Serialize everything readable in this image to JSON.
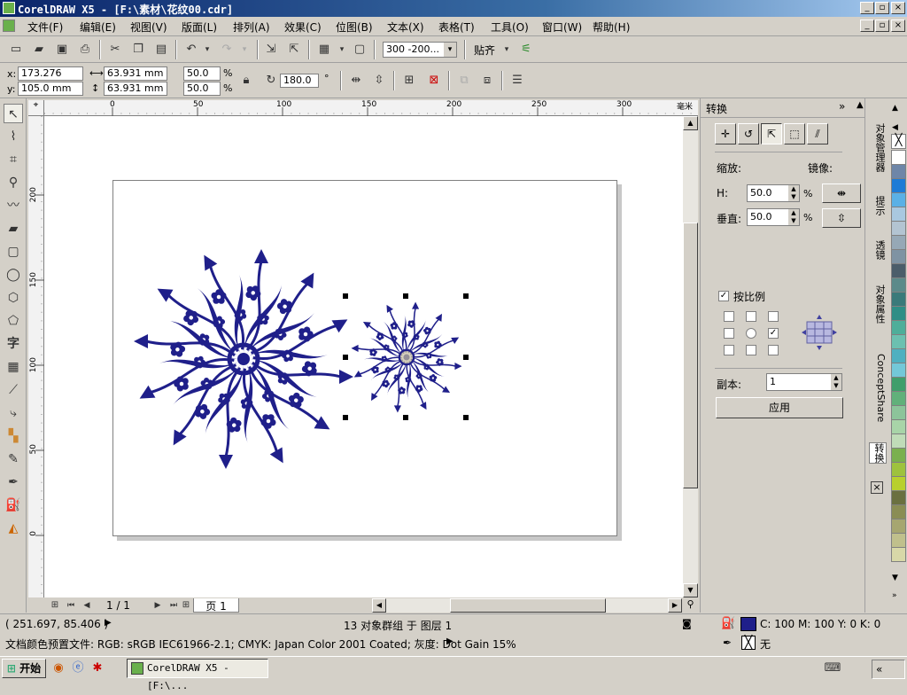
{
  "window": {
    "title": "CorelDRAW X5 - [F:\\素材\\花纹00.cdr]"
  },
  "menu": [
    "文件(F)",
    "编辑(E)",
    "视图(V)",
    "版面(L)",
    "排列(A)",
    "效果(C)",
    "位图(B)",
    "文本(X)",
    "表格(T)",
    "工具(O)",
    "窗口(W)",
    "帮助(H)"
  ],
  "toolbar": {
    "zoom_value": "300 -200...",
    "snap_label": "贴齐"
  },
  "propbar": {
    "x_label": "x:",
    "x_value": "173.276 mm",
    "y_label": "y:",
    "y_value": "105.0 mm",
    "w_value": "63.931 mm",
    "h_value": "63.931 mm",
    "sx_value": "50.0",
    "sy_value": "50.0",
    "percent": "%",
    "angle_value": "180.0",
    "deg": "°"
  },
  "ruler": {
    "h_ticks": [
      "0",
      "50",
      "100",
      "150",
      "200",
      "250",
      "300"
    ],
    "v_ticks": [
      "200",
      "150",
      "100",
      "50",
      "0"
    ],
    "unit": "毫米"
  },
  "page_nav": {
    "counter": "1 / 1",
    "page_tab": "页 1"
  },
  "docker": {
    "title": "转换",
    "scale_label": "缩放:",
    "mirror_label": "镜像:",
    "h_label": "H:",
    "h_value": "50.0",
    "v_label": "垂直:",
    "v_value": "50.0",
    "percent": "%",
    "proportional_label": "按比例",
    "copies_label": "副本:",
    "copies_value": "1",
    "apply_label": "应用"
  },
  "side_tabs": [
    "对象管理器",
    "提示",
    "透镜",
    "对象属性",
    "ConceptShare",
    "转换"
  ],
  "palette_colors": [
    "#ffffff",
    "#6e86a8",
    "#1e7bd6",
    "#5ab0e6",
    "#a9c8e0",
    "#b3c4d2",
    "#96a8b6",
    "#7f93a3",
    "#4b5d6a",
    "#5c8a8a",
    "#3a7a7a",
    "#2f8e86",
    "#4eae9a",
    "#6cc0b0",
    "#4fb0c0",
    "#73c8d8",
    "#3f9e6b",
    "#61b07a",
    "#8cc49a",
    "#a8d4a8",
    "#c0dcb8",
    "#7ab04e",
    "#9ec23e",
    "#b8d02e",
    "#6a7040",
    "#8a8d54",
    "#a6a670",
    "#c0c08c",
    "#d8d8a8"
  ],
  "status": {
    "coords": "( 251.697, 85.406 )",
    "selection": "13 对象群组 于 图层 1",
    "doc_info": "文档颜色预置文件: RGB: sRGB IEC61966-2.1; CMYK: Japan Color 2001 Coated; 灰度: Dot Gain 15%",
    "fill_info": "C: 100 M: 100 Y: 0 K: 0",
    "outline_info": "无",
    "fill_color": "#1f1f8a"
  },
  "taskbar": {
    "start_label": "开始",
    "task_label": "CorelDRAW X5 - [F:\\..."
  },
  "artwork": {
    "color": "#1f1f8a"
  }
}
